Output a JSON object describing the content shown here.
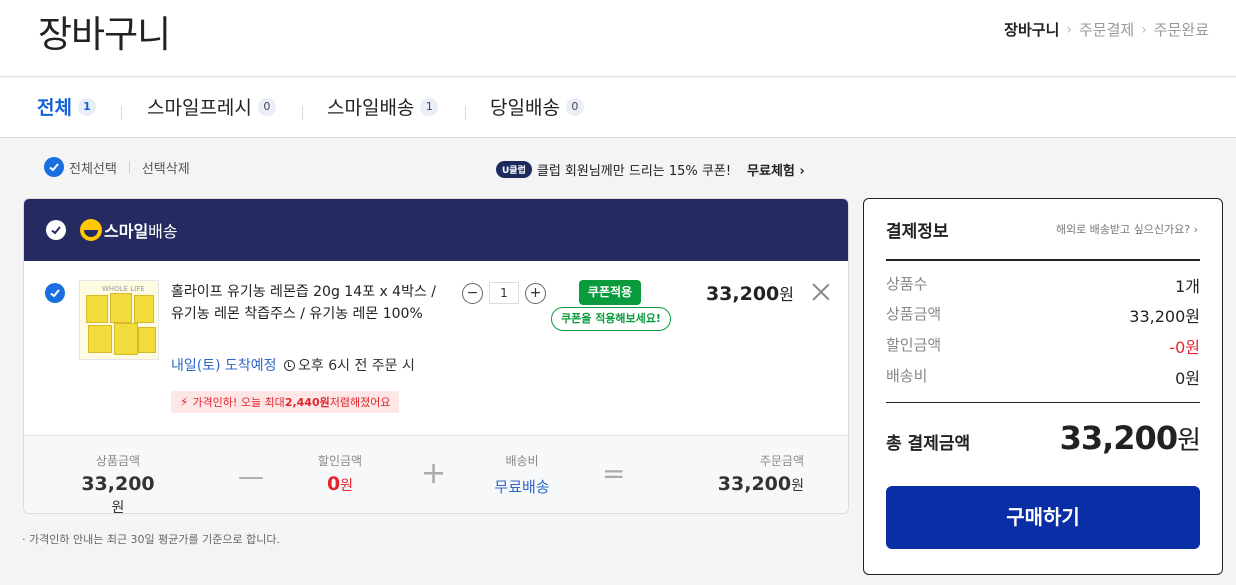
{
  "header": {
    "title": "장바구니",
    "steps": [
      "장바구니",
      "주문결제",
      "주문완료"
    ]
  },
  "tabs": [
    {
      "label": "전체",
      "count": "1"
    },
    {
      "label": "스마일프레시",
      "count": "0"
    },
    {
      "label": "스마일배송",
      "count": "1"
    },
    {
      "label": "당일배송",
      "count": "0"
    }
  ],
  "selection": {
    "select_all": "전체선택",
    "delete_selected": "선택삭제"
  },
  "promo": {
    "badge": "U클럽",
    "text": "클럽 회원님께만 드리는 15% 쿠폰!",
    "try_label": "무료체험 ›"
  },
  "group": {
    "name_bold": "스마일",
    "name_rest": "배송"
  },
  "item": {
    "title": "홀라이프 유기농 레몬즙 20g 14포 x 4박스 / 유기농 레몬 착즙주스 / 유기농 레몬 100%",
    "thumb_brand": "WHOLE LIFE",
    "arrival": "내일(토) 도착예정",
    "deadline": "오후 6시 전 주문 시",
    "price_drop_prefix": "가격인하! 오늘 최대 ",
    "price_drop_amount": "2,440원",
    "price_drop_suffix": " 저렴해졌어요",
    "quantity": "1",
    "coupon_button": "쿠폰적용",
    "coupon_hint": "쿠폰을 적용해보세요!",
    "price": "33,200",
    "won": "원"
  },
  "summary": {
    "product_label": "상품금액",
    "product_value": "33,200",
    "discount_label": "할인금액",
    "discount_value": "0",
    "shipping_label": "배송비",
    "shipping_value": "무료배송",
    "order_label": "주문금액",
    "order_value": "33,200",
    "won": "원"
  },
  "note": "· 가격인하 안내는 최근 30일 평균가를 기준으로 합니다.",
  "payment": {
    "title": "결제정보",
    "abroad": "해외로 배송받고 싶으신가요? ›",
    "rows": [
      {
        "label": "상품수",
        "value": "1개"
      },
      {
        "label": "상품금액",
        "value": "33,200원"
      },
      {
        "label": "할인금액",
        "value": "-0원"
      },
      {
        "label": "배송비",
        "value": "0원"
      }
    ],
    "total_label": "총 결제금액",
    "total_value": "33,200",
    "total_won": "원",
    "buy_button": "구매하기"
  },
  "colors": {
    "accent_blue": "#1460d4",
    "group_header": "#252a61",
    "coupon_green": "#0a9c3c",
    "buy_button": "#0a2ea5",
    "discount_red": "#e3262e"
  }
}
